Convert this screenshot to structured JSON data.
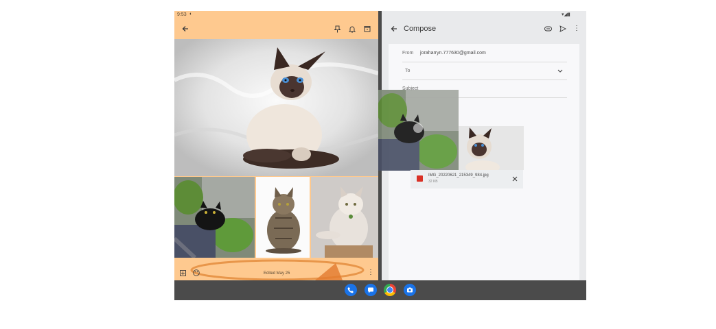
{
  "status": {
    "time": "9:53"
  },
  "notes": {
    "edited_label": "Edited May 25"
  },
  "compose": {
    "title": "Compose",
    "from_label": "From",
    "from_value": "joraharryn.777630@gmail.com",
    "to_label": "To",
    "subject_label": "Subject"
  },
  "attachment": {
    "filename": "IMG_20220621_215349_984.jpg",
    "size": "32 KB"
  },
  "dock": {
    "apps": [
      "phone-app",
      "messages-app",
      "chrome-app",
      "camera-app"
    ]
  },
  "colors": {
    "notes_bg": "#fec98f",
    "compose_bg": "#f8f8fa",
    "dock_bg": "#4b4b4b",
    "phone": "#1a73e8",
    "messages": "#1a73e8",
    "camera": "#1a73e8"
  }
}
